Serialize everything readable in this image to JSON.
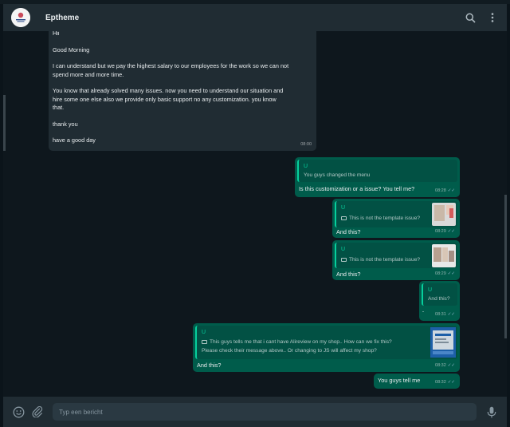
{
  "header": {
    "contact_name": "Eptheme",
    "search_icon": "search-icon",
    "menu_icon": "more-vertical-icon"
  },
  "incoming": {
    "lines": [
      "Hii",
      "Good Morning",
      "I can understand but we pay the highest salary to our employees for the work so we can not",
      "spend more and more time.",
      "You know that already solved many issues. now you need to understand our situation and",
      "hire some one else also  we provide only basic support no any customization. you know",
      "that.",
      "thank you",
      "have a good day"
    ],
    "time": "08:00"
  },
  "outgoing": [
    {
      "quote_name": "U",
      "quote_text": "You guys changed the menu",
      "text": "Is this customization or a issue? You tell me?",
      "time": "08:28",
      "ticks": "✓✓"
    },
    {
      "quote_name": "U",
      "quote_text": "This is not the template issue?",
      "text": "And this?",
      "time": "08:29",
      "ticks": "✓✓"
    },
    {
      "quote_name": "U",
      "quote_text": "This is not the template issue?",
      "text": "And this?",
      "time": "08:29",
      "ticks": "✓✓"
    },
    {
      "quote_name": "U",
      "quote_text": "And this?",
      "text": "-",
      "time": "08:31",
      "ticks": "✓✓"
    },
    {
      "quote_name": "U",
      "quote_line1": "This guys tells me that i cant have Alireview on my shop.. How can we fix this?",
      "quote_line2": "Please check their message above.. Or changing to JS will affect my shop?",
      "text": "And this?",
      "time": "08:32",
      "ticks": "✓✓"
    },
    {
      "text": "You guys tell me",
      "time": "08:32",
      "ticks": "✓✓"
    }
  ],
  "footer": {
    "placeholder": "Typ een bericht",
    "emoji_icon": "emoji-icon",
    "attach_icon": "paperclip-icon",
    "mic_icon": "microphone-icon"
  },
  "colors": {
    "incoming_bubble": "#202c33",
    "outgoing_bubble": "#005c4b",
    "quote_accent": "#06cf9c",
    "read_ticks": "#8fb9cf"
  }
}
